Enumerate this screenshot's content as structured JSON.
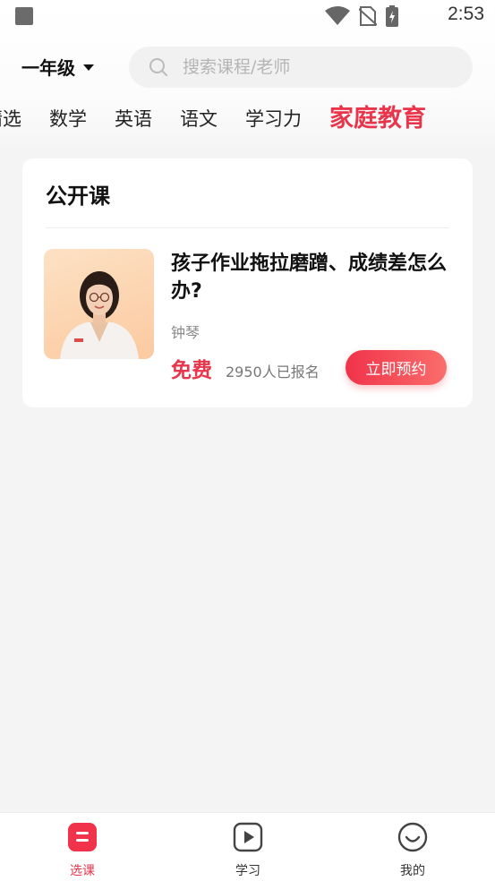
{
  "status_bar": {
    "time": "2:53"
  },
  "header": {
    "grade": "一年级",
    "search_placeholder": "搜索课程/老师"
  },
  "tabs": [
    "精选",
    "数学",
    "英语",
    "语文",
    "学习力",
    "家庭教育"
  ],
  "active_tab": "家庭教育",
  "section": {
    "title": "公开课",
    "course": {
      "title": "孩子作业拖拉磨蹭、成绩差怎么办?",
      "teacher": "钟琴",
      "price": "免费",
      "enrolled": "2950人已报名",
      "button": "立即预约"
    }
  },
  "bottom_nav": [
    {
      "label": "选课",
      "icon": "course-select-icon",
      "active": true
    },
    {
      "label": "学习",
      "icon": "play-icon",
      "active": false
    },
    {
      "label": "我的",
      "icon": "smile-icon",
      "active": false
    }
  ],
  "colors": {
    "accent": "#e8354b",
    "background": "#f4f4f4"
  }
}
